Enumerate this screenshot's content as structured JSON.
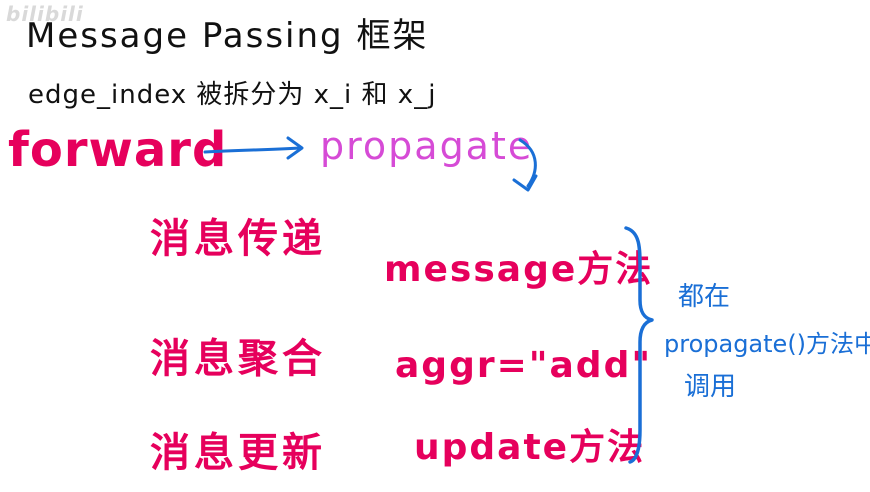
{
  "watermark": "bilibili",
  "title": "Message Passing 框架",
  "subtitle": "edge_index 被拆分为 x_i 和 x_j",
  "flow": {
    "from": "forward",
    "to": "propagate"
  },
  "steps": [
    {
      "label": "消息传递",
      "method": "message方法"
    },
    {
      "label": "消息聚合",
      "method": "aggr=\"add\""
    },
    {
      "label": "消息更新",
      "method": "update方法"
    }
  ],
  "note": {
    "line1": "都在",
    "line2": "propagate()方法中",
    "line3": "调用"
  },
  "colors": {
    "black": "#111111",
    "pink": "#e6005c",
    "violet": "#d64bd6",
    "blue": "#1a6fd6"
  }
}
